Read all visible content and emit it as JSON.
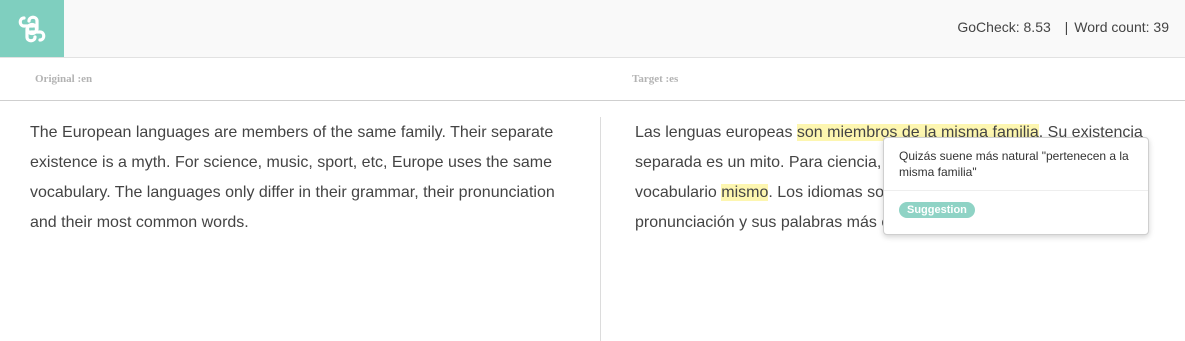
{
  "header": {
    "logo_icon": "gocheck-logo-icon",
    "gocheck_label": "GoCheck:",
    "gocheck_score": "8.53",
    "separator": "|",
    "word_count_label": "Word count:",
    "word_count": "39",
    "accent_color": "#7fcfbf"
  },
  "columns": {
    "source_label": "Original :en",
    "target_label": "Target :es"
  },
  "source_text": "The European languages are members of the same family. Their separate existence is a myth. For science, music, sport, etc, Europe uses the same vocabulary. The languages only differ in their grammar, their pronunciation and their most common words.",
  "target_text": {
    "part1": "Las lenguas europeas ",
    "highlight1": "son miembros de la misma familia",
    "part2": ". Su existencia separada es un mito. Para ciencia, música, deporte, etc., Europa usa el vocabulario ",
    "highlight2": "mismo",
    "part3": ". Los idiomas solo difieren en su gramática, su pronunciación y sus palabras más comunes."
  },
  "popup": {
    "message": "Quizás suene más natural \"pertenecen a la misma familia\"",
    "badge": "Suggestion",
    "highlight_color": "#fdf6b0"
  }
}
